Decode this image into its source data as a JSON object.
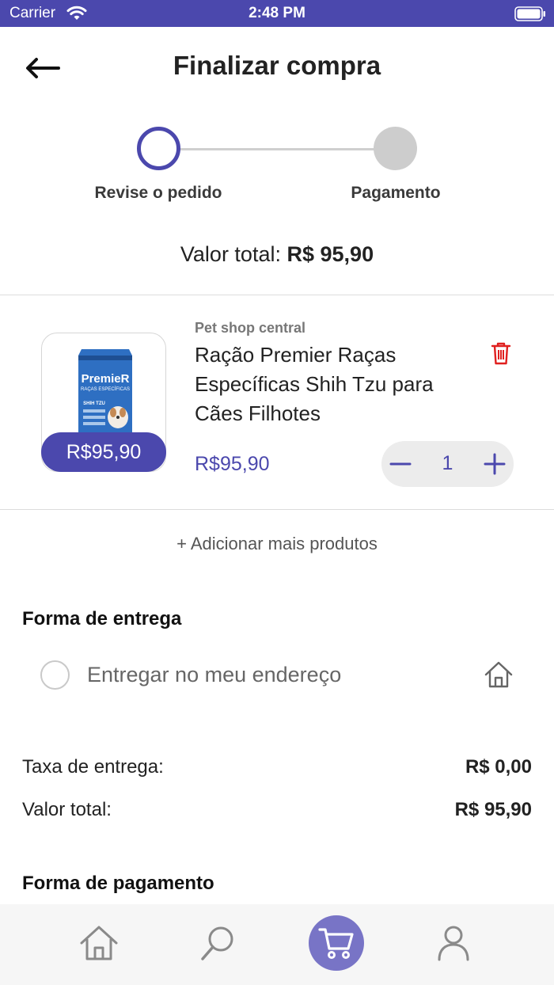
{
  "status_bar": {
    "carrier": "Carrier",
    "time": "2:48 PM"
  },
  "header": {
    "title": "Finalizar compra",
    "back_icon": "arrow-left-icon"
  },
  "stepper": {
    "steps": [
      {
        "label": "Revise o pedido",
        "state": "active"
      },
      {
        "label": "Pagamento",
        "state": "inactive"
      }
    ]
  },
  "summary": {
    "total_label": "Valor total:",
    "total_value": "R$ 95,90"
  },
  "cart_item": {
    "store": "Pet shop central",
    "name": "Ração Premier Raças Específicas Shih Tzu para Cães Filhotes",
    "thumb_price": "R$95,90",
    "price": "R$95,90",
    "quantity": "1",
    "image_brand": "PremieR",
    "image_subtitle": "RAÇAS ESPECÍFICAS",
    "image_breed": "SHIH TZU"
  },
  "add_more": {
    "label": "+ Adicionar mais produtos"
  },
  "delivery": {
    "title": "Forma de entrega",
    "option_label": "Entregar no meu endereço",
    "option_selected": false
  },
  "fees": {
    "delivery_fee_label": "Taxa de entrega:",
    "delivery_fee_value": "R$ 0,00",
    "total_label": "Valor total:",
    "total_value": "R$ 95,90"
  },
  "payment": {
    "title": "Forma de pagamento"
  },
  "tab_bar": {
    "items": [
      {
        "name": "home",
        "icon": "home-icon"
      },
      {
        "name": "search",
        "icon": "search-icon"
      },
      {
        "name": "cart",
        "icon": "cart-icon",
        "active": true
      },
      {
        "name": "profile",
        "icon": "user-icon"
      }
    ]
  },
  "colors": {
    "primary": "#4b48ad",
    "primary_light": "#7874c6",
    "danger": "#e0201f",
    "inactive": "#cdcdcd"
  }
}
